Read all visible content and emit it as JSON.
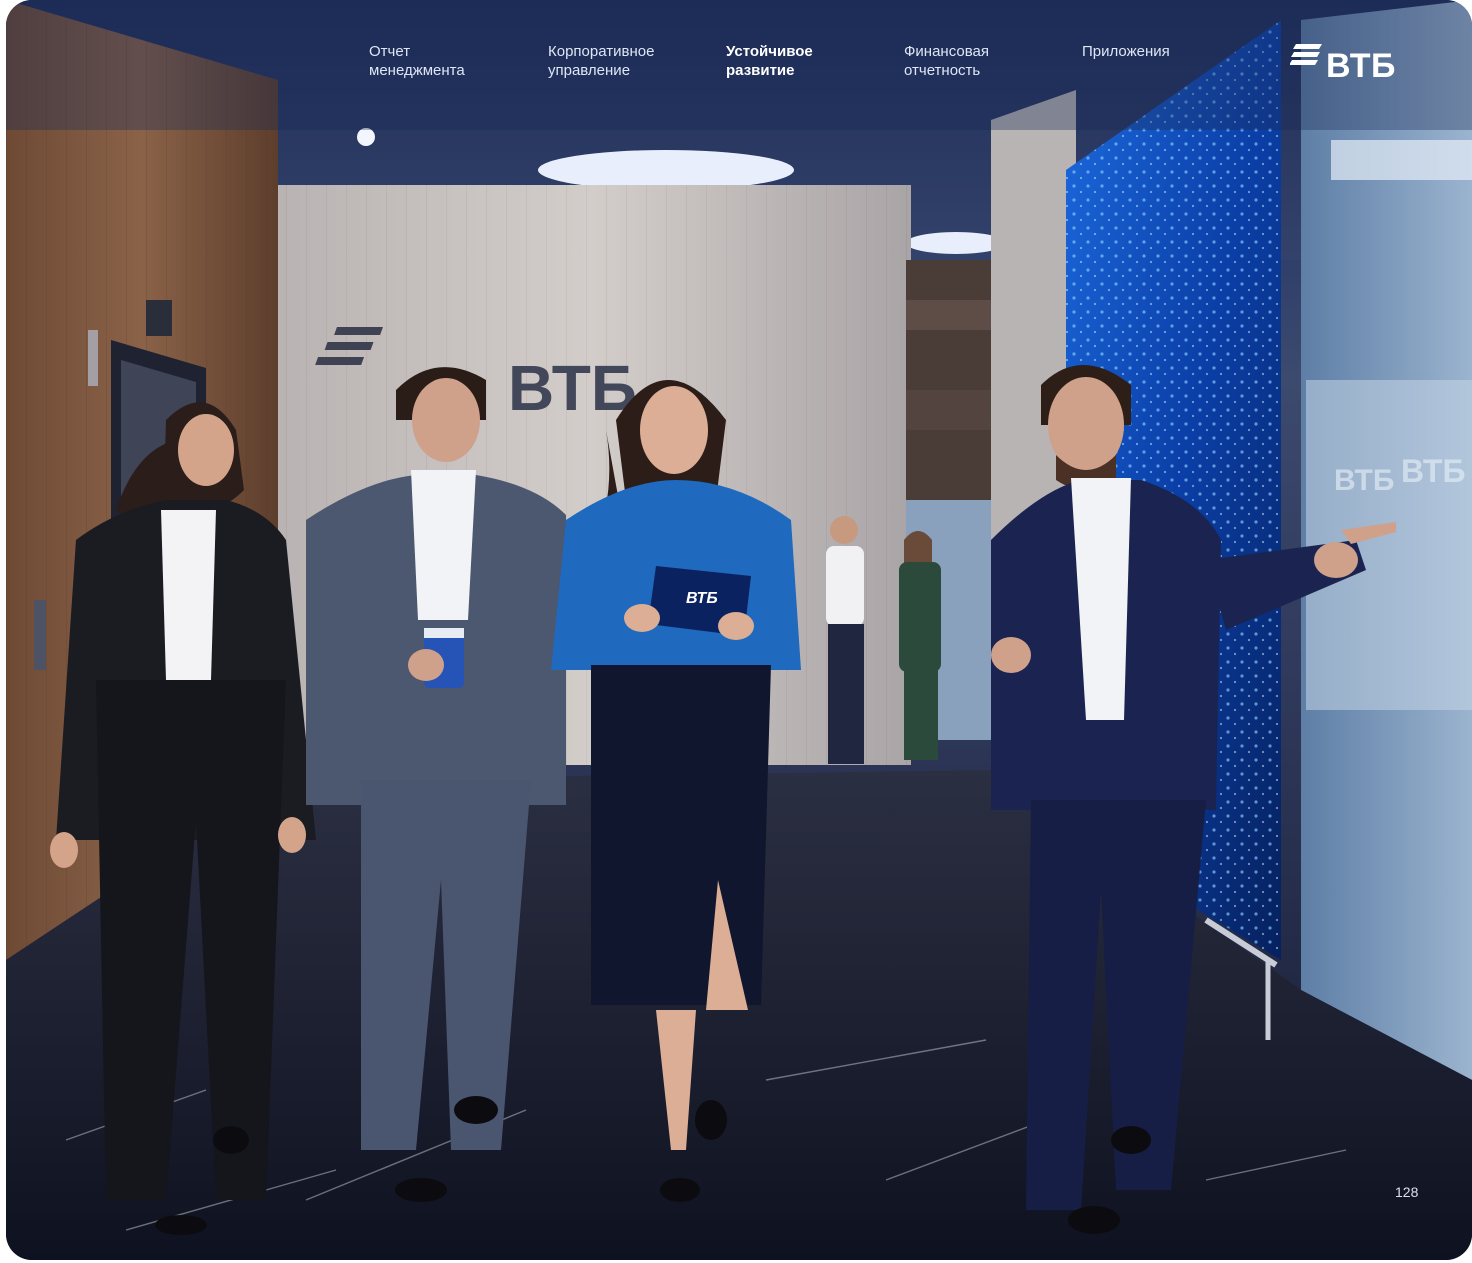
{
  "nav": {
    "items": [
      {
        "label": "Отчет\nменеджмента",
        "active": false
      },
      {
        "label": "Корпоративное\nуправление",
        "active": false
      },
      {
        "label": "Устойчивое\nразвитие",
        "active": true
      },
      {
        "label": "Финансовая\nотчетность",
        "active": false
      },
      {
        "label": "Приложения",
        "active": false
      }
    ]
  },
  "logo": {
    "text": "ВТБ"
  },
  "photo": {
    "wall_logo": "ВТБ",
    "tablet_logo": "ВТБ",
    "glass_logos": [
      "ВТБ",
      "ВТБ"
    ]
  },
  "page_number": "128",
  "colors": {
    "brand_blue": "#0a2896",
    "nav_text": "#dfe6f5",
    "background_dark": "#141a30"
  }
}
